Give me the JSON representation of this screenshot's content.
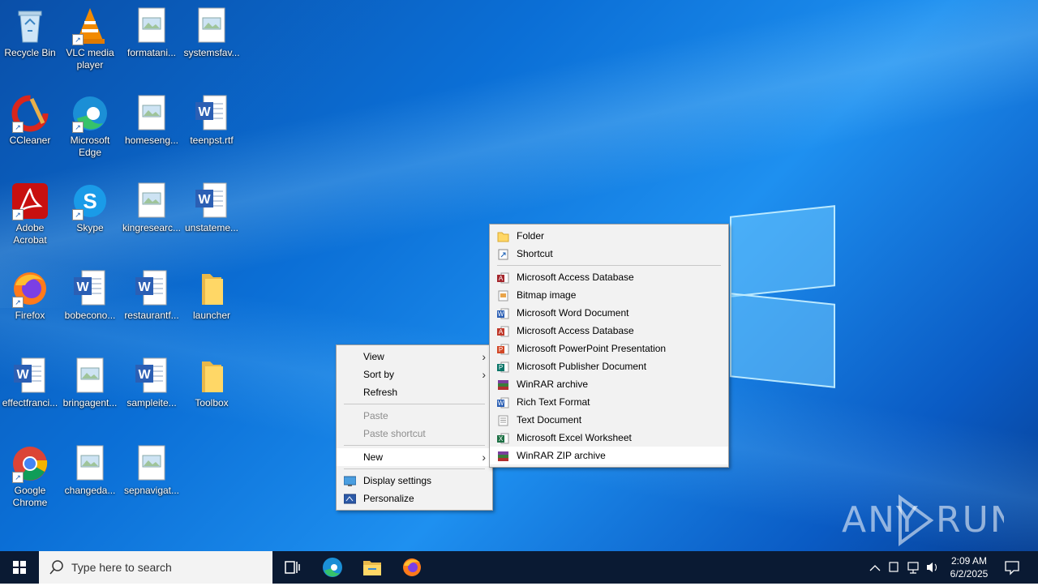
{
  "desktop_icons": [
    {
      "label": "Recycle Bin",
      "icon": "recycle-bin-icon"
    },
    {
      "label": "VLC media player",
      "icon": "vlc-icon"
    },
    {
      "label": "formatani...",
      "icon": "image-file-icon"
    },
    {
      "label": "systemsfav...",
      "icon": "image-file-icon"
    },
    {
      "label": "CCleaner",
      "icon": "ccleaner-icon"
    },
    {
      "label": "Microsoft Edge",
      "icon": "edge-icon"
    },
    {
      "label": "homeseng...",
      "icon": "image-file-icon"
    },
    {
      "label": "teenpst.rtf",
      "icon": "word-doc-icon"
    },
    {
      "label": "Adobe Acrobat",
      "icon": "acrobat-icon"
    },
    {
      "label": "Skype",
      "icon": "skype-icon"
    },
    {
      "label": "kingresearc...",
      "icon": "image-file-icon"
    },
    {
      "label": "unstateme...",
      "icon": "word-doc-icon"
    },
    {
      "label": "Firefox",
      "icon": "firefox-icon"
    },
    {
      "label": "bobecono...",
      "icon": "word-doc-icon"
    },
    {
      "label": "restaurantf...",
      "icon": "word-doc-icon"
    },
    {
      "label": "launcher",
      "icon": "folder-icon"
    },
    {
      "label": "effectfranci...",
      "icon": "word-doc-icon"
    },
    {
      "label": "bringagent...",
      "icon": "image-file-icon"
    },
    {
      "label": "sampleite...",
      "icon": "word-doc-icon"
    },
    {
      "label": "Toolbox",
      "icon": "folder-icon"
    },
    {
      "label": "Google Chrome",
      "icon": "chrome-icon"
    },
    {
      "label": "changeda...",
      "icon": "image-file-icon"
    },
    {
      "label": "sepnavigat...",
      "icon": "image-file-icon"
    }
  ],
  "context_menu": {
    "view": "View",
    "sort_by": "Sort by",
    "refresh": "Refresh",
    "paste": "Paste",
    "paste_shortcut": "Paste shortcut",
    "new": "New",
    "display_settings": "Display settings",
    "personalize": "Personalize"
  },
  "new_submenu": {
    "items": [
      {
        "label": "Folder",
        "icon": "folder-icon"
      },
      {
        "label": "Shortcut",
        "icon": "shortcut-icon"
      },
      {
        "label": "Microsoft Access Database",
        "icon": "access-icon"
      },
      {
        "label": "Bitmap image",
        "icon": "bitmap-icon"
      },
      {
        "label": "Microsoft Word Document",
        "icon": "word-icon"
      },
      {
        "label": "Microsoft Access Database",
        "icon": "access-icon"
      },
      {
        "label": "Microsoft PowerPoint Presentation",
        "icon": "powerpoint-icon"
      },
      {
        "label": "Microsoft Publisher Document",
        "icon": "publisher-icon"
      },
      {
        "label": "WinRAR archive",
        "icon": "winrar-icon"
      },
      {
        "label": "Rich Text Format",
        "icon": "rtf-icon"
      },
      {
        "label": "Text Document",
        "icon": "text-icon"
      },
      {
        "label": "Microsoft Excel Worksheet",
        "icon": "excel-icon"
      },
      {
        "label": "WinRAR ZIP archive",
        "icon": "winrar-zip-icon"
      }
    ]
  },
  "taskbar": {
    "search_placeholder": "Type here to search",
    "time": "2:09 AM",
    "date": "6/2/2025"
  },
  "watermark": "ANY RUN",
  "colors": {
    "accent": "#0078d7",
    "taskbar": "#0a1a33",
    "menu_bg": "#f2f2f2"
  }
}
